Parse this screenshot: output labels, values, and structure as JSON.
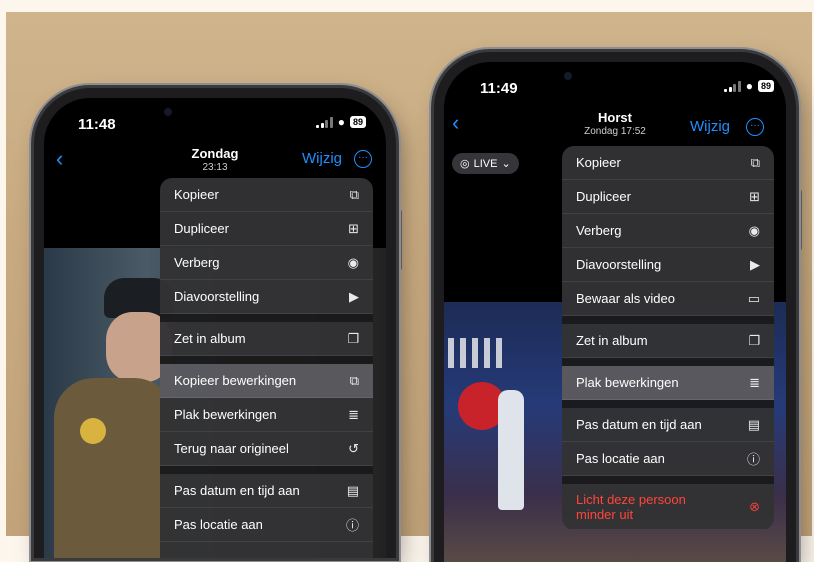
{
  "left_phone": {
    "time": "11:48",
    "battery": "89",
    "nav": {
      "title": "Zondag",
      "subtitle": "23:13",
      "edit": "Wijzig"
    },
    "menu": [
      {
        "label": "Kopieer",
        "icon": "copy-icon"
      },
      {
        "label": "Dupliceer",
        "icon": "duplicate-icon"
      },
      {
        "label": "Verberg",
        "icon": "eye-slash-icon"
      },
      {
        "label": "Diavoorstelling",
        "icon": "play-icon"
      },
      {
        "label": "Zet in album",
        "icon": "album-icon"
      },
      {
        "label": "Kopieer bewerkingen",
        "icon": "copy-edits-icon"
      },
      {
        "label": "Plak bewerkingen",
        "icon": "paste-edits-icon"
      },
      {
        "label": "Terug naar origineel",
        "icon": "revert-icon"
      },
      {
        "label": "Pas datum en tijd aan",
        "icon": "calendar-icon"
      },
      {
        "label": "Pas locatie aan",
        "icon": "location-icon"
      }
    ]
  },
  "right_phone": {
    "time": "11:49",
    "battery": "89",
    "nav": {
      "title": "Horst",
      "subtitle": "Zondag  17:52",
      "edit": "Wijzig"
    },
    "live_label": "LIVE",
    "menu": [
      {
        "label": "Kopieer",
        "icon": "copy-icon"
      },
      {
        "label": "Dupliceer",
        "icon": "duplicate-icon"
      },
      {
        "label": "Verberg",
        "icon": "eye-slash-icon"
      },
      {
        "label": "Diavoorstelling",
        "icon": "play-icon"
      },
      {
        "label": "Bewaar als video",
        "icon": "video-icon"
      },
      {
        "label": "Zet in album",
        "icon": "album-icon"
      },
      {
        "label": "Plak bewerkingen",
        "icon": "paste-edits-icon"
      },
      {
        "label": "Pas datum en tijd aan",
        "icon": "calendar-icon"
      },
      {
        "label": "Pas locatie aan",
        "icon": "location-icon"
      },
      {
        "label": "Licht deze persoon minder uit",
        "icon": "remove-icon"
      }
    ]
  },
  "colors": {
    "accent": "#1e90ff",
    "danger": "#ff453a",
    "menu_bg": "#323234"
  }
}
